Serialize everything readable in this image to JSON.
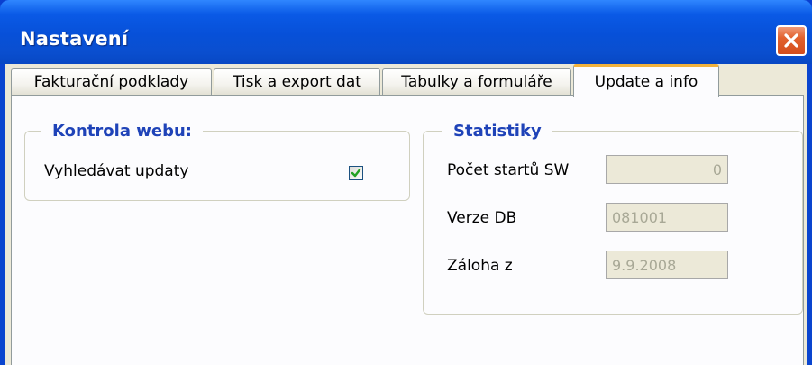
{
  "window": {
    "title": "Nastavení"
  },
  "tabs": [
    {
      "label": "Fakturační podklady"
    },
    {
      "label": "Tisk a export dat"
    },
    {
      "label": "Tabulky a formuláře"
    },
    {
      "label": "Update a info",
      "active": true
    }
  ],
  "web_check": {
    "title": "Kontrola webu:",
    "search_updates_label": "Vyhledávat updaty",
    "search_updates_checked": true
  },
  "stats": {
    "title": "Statistiky",
    "rows": [
      {
        "label": "Počet startů SW",
        "value": "0"
      },
      {
        "label": "Verze DB",
        "value": "081001"
      },
      {
        "label": "Záloha z",
        "value": "9.9.2008"
      }
    ]
  },
  "colors": {
    "titlebar": "#0750d8",
    "client_bg": "#ece9d8",
    "group_title": "#1f43b8",
    "active_tab_accent": "#f2b23c",
    "close_button": "#d44d1c"
  },
  "icons": {
    "close": "close-icon",
    "check": "checkmark-icon"
  }
}
